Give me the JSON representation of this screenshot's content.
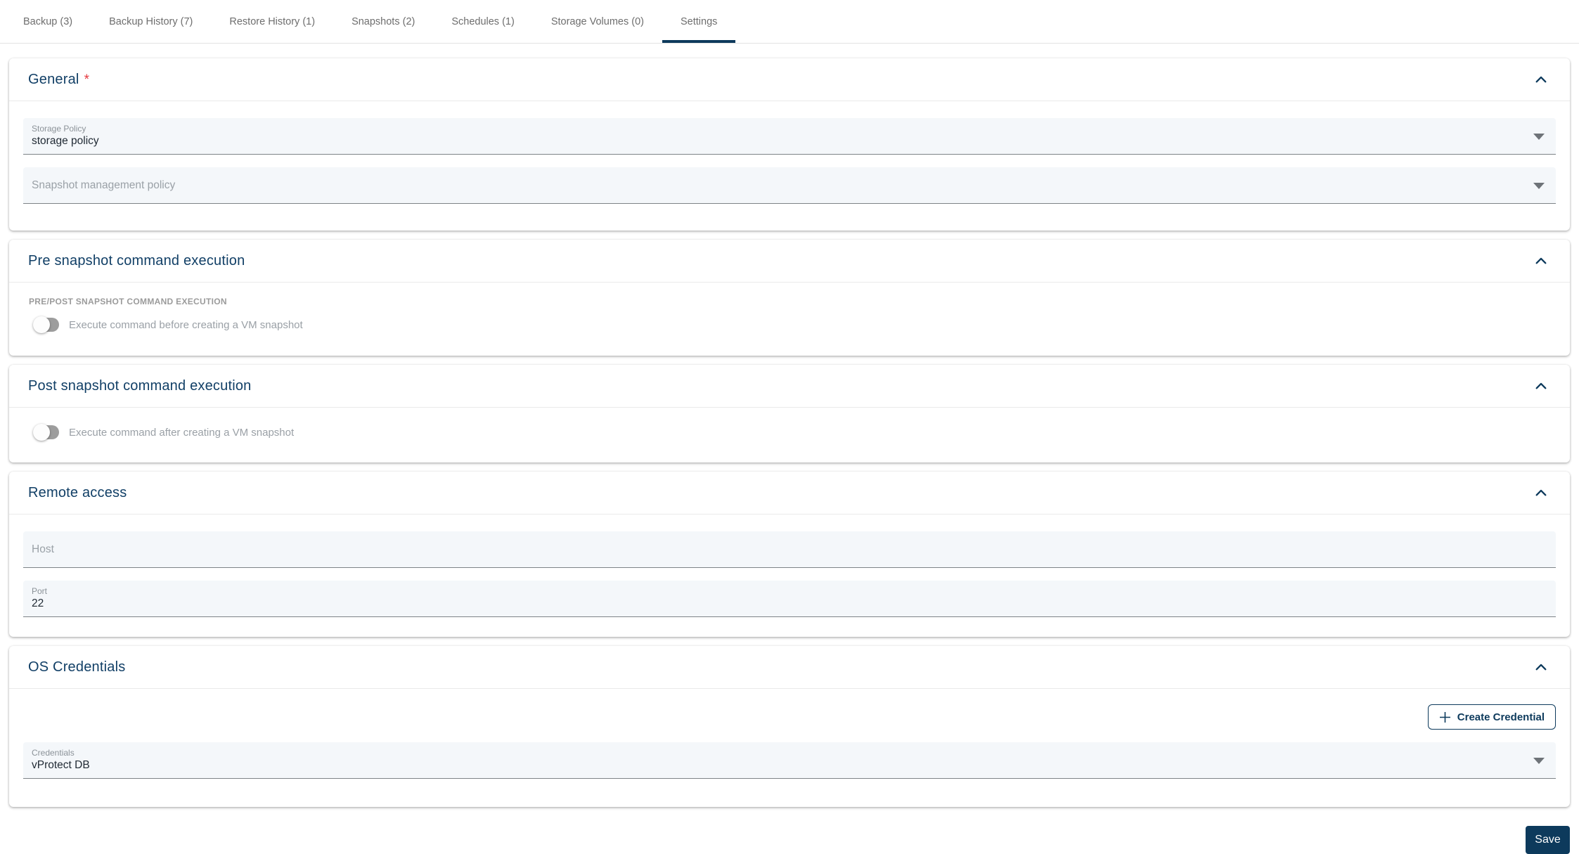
{
  "tabs": [
    {
      "label": "Backup (3)"
    },
    {
      "label": "Backup History (7)"
    },
    {
      "label": "Restore History (1)"
    },
    {
      "label": "Snapshots (2)"
    },
    {
      "label": "Schedules (1)"
    },
    {
      "label": "Storage Volumes (0)"
    },
    {
      "label": "Settings"
    }
  ],
  "active_tab": "Settings",
  "general": {
    "title": "General",
    "required_marker": "*",
    "storage_policy": {
      "label": "Storage Policy",
      "value": "storage policy"
    },
    "snapshot_policy": {
      "placeholder": "Snapshot management policy",
      "value": ""
    }
  },
  "pre_snapshot": {
    "title": "Pre snapshot command execution",
    "group_label": "PRE/POST SNAPSHOT COMMAND EXECUTION",
    "toggle_label": "Execute command before creating a VM snapshot",
    "toggle_state": "off"
  },
  "post_snapshot": {
    "title": "Post snapshot command execution",
    "toggle_label": "Execute command after creating a VM snapshot",
    "toggle_state": "off"
  },
  "remote_access": {
    "title": "Remote access",
    "host": {
      "placeholder": "Host",
      "value": ""
    },
    "port": {
      "label": "Port",
      "value": "22"
    }
  },
  "os_credentials": {
    "title": "OS Credentials",
    "create_button_label": "Create Credential",
    "credentials": {
      "label": "Credentials",
      "value": "vProtect DB"
    }
  },
  "save_button_label": "Save",
  "colors": {
    "accent_navy": "#0d3a5c",
    "title_navy": "#113f66",
    "required_red": "#e5393f",
    "field_bg": "#f4f7fa",
    "field_border": "#7e8387",
    "muted_text": "#9aa1a7"
  }
}
